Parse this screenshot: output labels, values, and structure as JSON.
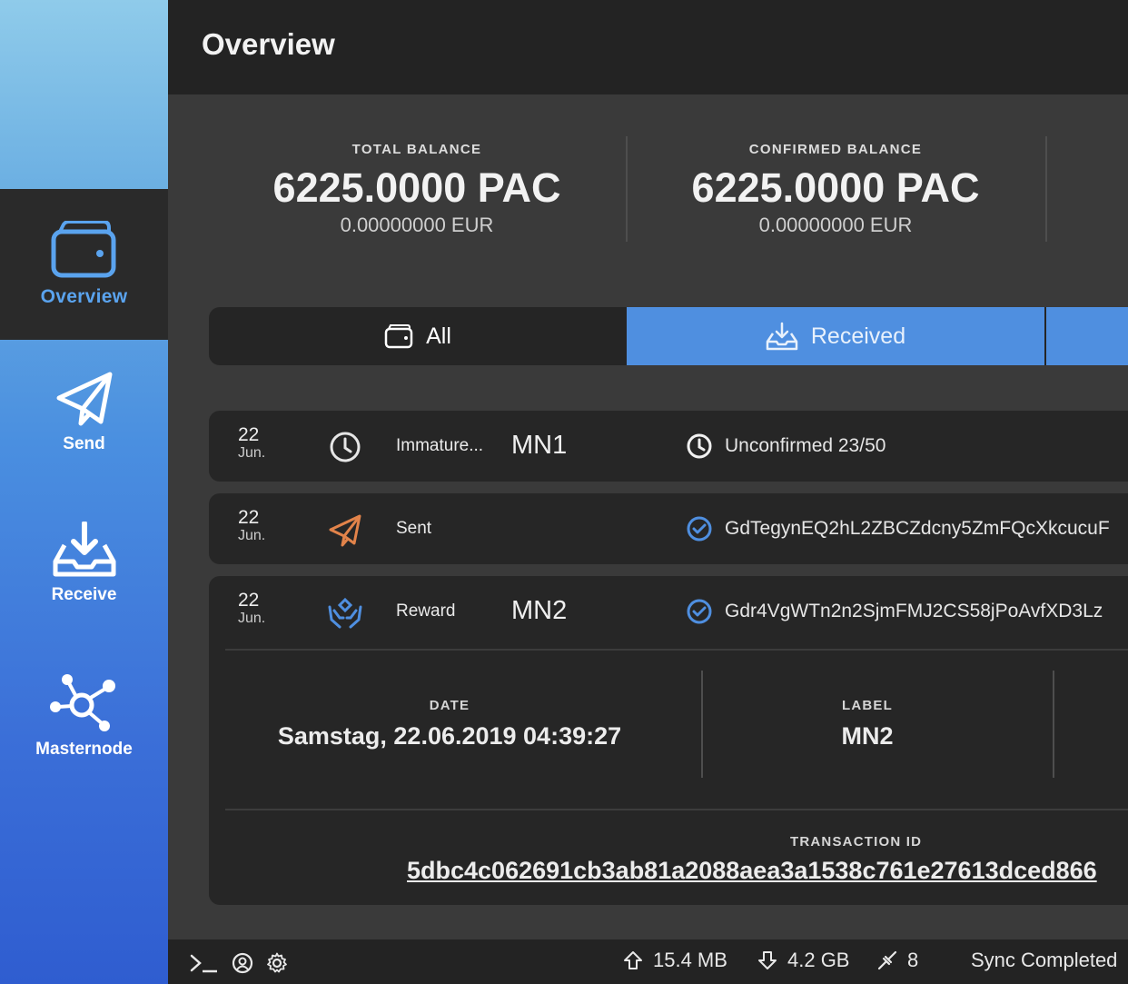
{
  "header": {
    "title": "Overview"
  },
  "sidebar": {
    "items": [
      {
        "label": "Overview",
        "icon": "wallet-icon",
        "active": true
      },
      {
        "label": "Send",
        "icon": "send-icon"
      },
      {
        "label": "Receive",
        "icon": "receive-icon"
      },
      {
        "label": "Masternode",
        "icon": "masternode-icon"
      }
    ]
  },
  "balances": {
    "total": {
      "caption": "TOTAL BALANCE",
      "amount": "6225.0000 PAC",
      "fiat": "0.00000000 EUR"
    },
    "confirmed": {
      "caption": "CONFIRMED BALANCE",
      "amount": "6225.0000 PAC",
      "fiat": "0.00000000 EUR"
    }
  },
  "tabs": [
    {
      "label": "All",
      "icon": "wallet-small-icon"
    },
    {
      "label": "Received",
      "icon": "inbox-download-icon",
      "active": true
    }
  ],
  "transactions": [
    {
      "day": "22",
      "month": "Jun.",
      "type": "Immature...",
      "label": "MN1",
      "icon": "clock-icon",
      "status_icon": "clock-icon",
      "status": "Unconfirmed 23/50"
    },
    {
      "day": "22",
      "month": "Jun.",
      "type": "Sent",
      "label": "",
      "icon": "send-icon",
      "status_icon": "check-circle-icon",
      "status": "GdTegynEQ2hL2ZBCZdcny5ZmFQcXkcucuF"
    },
    {
      "day": "22",
      "month": "Jun.",
      "type": "Reward",
      "label": "MN2",
      "icon": "reward-hands-icon",
      "status_icon": "check-circle-icon",
      "status": "Gdr4VgWTn2n2SjmFMJ2CS58jPoAvfXD3Lz"
    }
  ],
  "details": {
    "date_caption": "DATE",
    "date_value": "Samstag, 22.06.2019 04:39:27",
    "label_caption": "LABEL",
    "label_value": "MN2",
    "txid_caption": "TRANSACTION ID",
    "txid_value": "5dbc4c062691cb3ab81a2088aea3a1538c761e27613dced866"
  },
  "footer": {
    "upload": "15.4 MB",
    "download": "4.2 GB",
    "peers": "8",
    "sync": "Sync Completed"
  },
  "colors": {
    "accent": "#4f8fe0",
    "active_label": "#5aa3ee",
    "sent_orange": "#e2834a",
    "reward_blue": "#4f8fe0"
  }
}
